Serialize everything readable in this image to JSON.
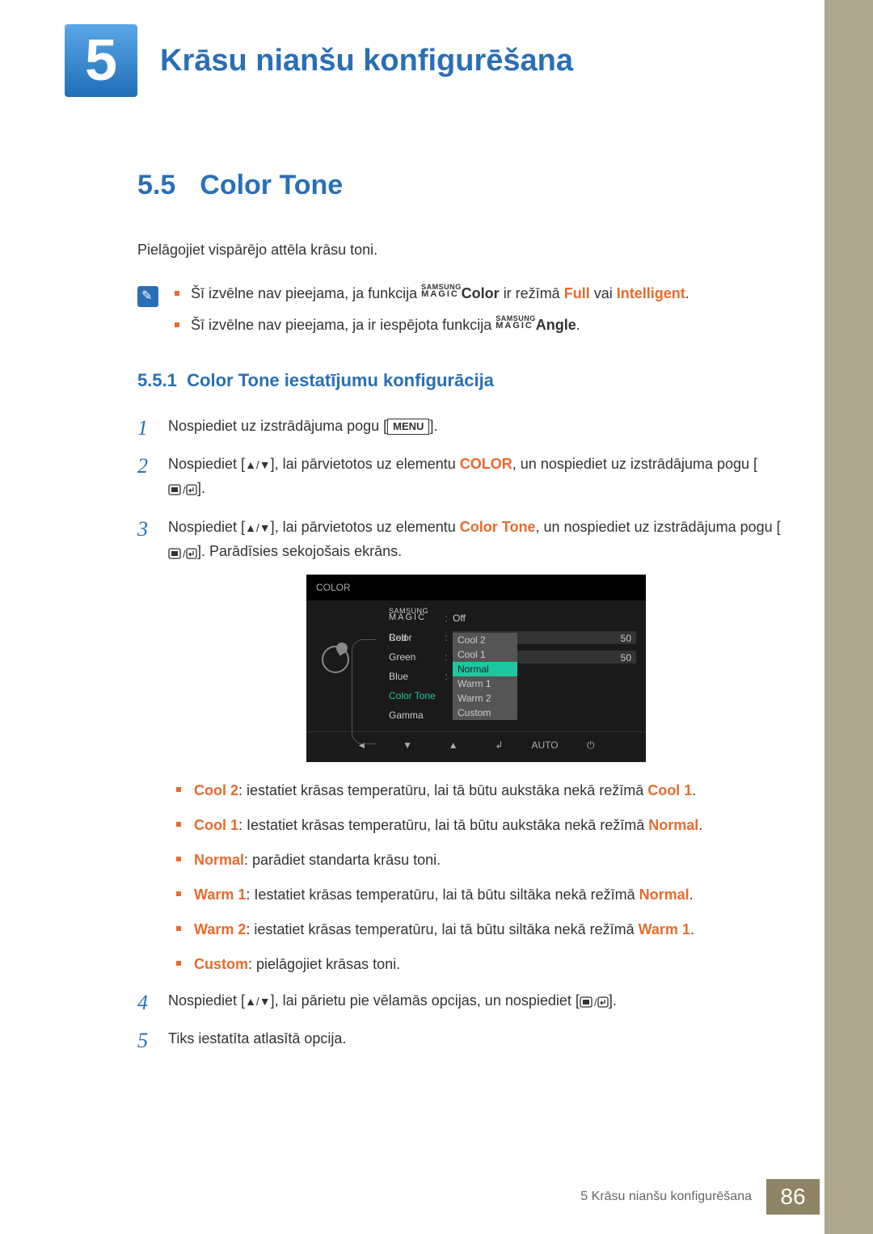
{
  "chapter": {
    "num": "5",
    "title": "Krāsu nianšu konfigurēšana"
  },
  "section": {
    "num": "5.5",
    "title": "Color Tone"
  },
  "intro": "Pielāgojiet vispārējo attēla krāsu toni.",
  "notes": {
    "n1_a": "Šī izvēlne nav pieejama, ja funkcija ",
    "n1_magic_small": "SAMSUNG",
    "n1_magic_big": "MAGIC",
    "n1_color": "Color",
    "n1_b": " ir režīmā ",
    "n1_full": "Full",
    "n1_or": " vai ",
    "n1_int": "Intelligent",
    "n2_a": "Šī izvēlne nav pieejama, ja ir iespējota funkcija ",
    "n2_angle": "Angle"
  },
  "subsection": {
    "num": "5.5.1",
    "title": "Color Tone iestatījumu konfigurācija"
  },
  "steps": {
    "s1_a": "Nospiediet uz izstrādājuma pogu [",
    "s1_menu": "MENU",
    "s1_b": "].",
    "s2_a": "Nospiediet [",
    "s2_b": "], lai pārvietotos uz elementu ",
    "s2_colorlbl": "COLOR",
    "s2_c": ", un nospiediet uz izstrādājuma pogu [",
    "s2_d": "].",
    "s3_a": "Nospiediet [",
    "s3_b": "], lai pārvietotos uz elementu ",
    "s3_ct": "Color Tone",
    "s3_c": ", un nospiediet uz izstrādājuma pogu [",
    "s3_d": "]. Parādīsies sekojošais ekrāns.",
    "s4_a": "Nospiediet [",
    "s4_b": "], lai pārietu pie vēlamās opcijas, un nospiediet [",
    "s4_c": "].",
    "s5": "Tiks iestatīta atlasītā opcija."
  },
  "osd": {
    "title": "COLOR",
    "magic_small": "SAMSUNG",
    "magic_big": "MAGIC",
    "magic_lbl": " Color",
    "magic_val": "Off",
    "red": "Red",
    "red_v": "50",
    "green": "Green",
    "green_v": "50",
    "blue": "Blue",
    "colortone": "Color Tone",
    "gamma": "Gamma",
    "dropdown": [
      "Cool 2",
      "Cool 1",
      "Normal",
      "Warm 1",
      "Warm 2",
      "Custom"
    ],
    "sel_idx": 2,
    "auto": "AUTO"
  },
  "tones": {
    "cool2_n": "Cool 2",
    "cool2_t": ": iestatiet krāsas temperatūru, lai tā būtu aukstāka nekā režīmā ",
    "cool2_r": "Cool 1",
    "cool1_n": "Cool 1",
    "cool1_t": ": Iestatiet krāsas temperatūru, lai tā būtu aukstāka nekā režīmā ",
    "cool1_r": "Normal",
    "normal_n": "Normal",
    "normal_t": ": parādiet standarta krāsu toni.",
    "warm1_n": "Warm 1",
    "warm1_t": ": Iestatiet krāsas temperatūru, lai tā būtu siltāka nekā režīmā ",
    "warm1_r": "Normal",
    "warm2_n": "Warm 2",
    "warm2_t": ": iestatiet krāsas temperatūru, lai tā būtu siltāka nekā režīmā ",
    "warm2_r": "Warm 1",
    "custom_n": "Custom",
    "custom_t": ": pielāgojiet krāsas toni."
  },
  "footer": {
    "text": "5 Krāsu nianšu konfigurēšana",
    "page": "86"
  }
}
